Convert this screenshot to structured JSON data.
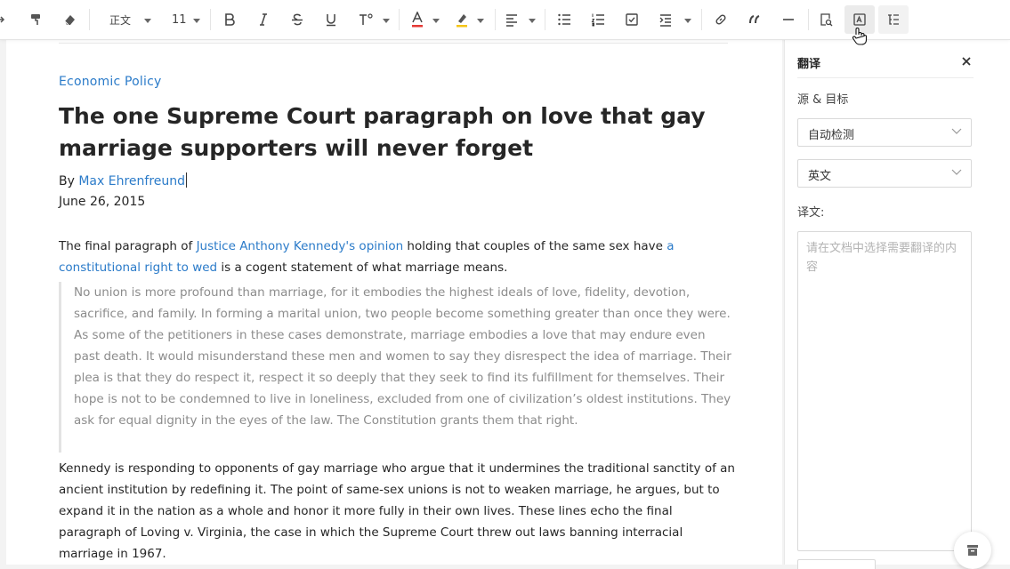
{
  "toolbar": {
    "style_value": "正文",
    "font_size_value": "11",
    "accent_color": "#e53935",
    "highlight_color": "#f5c518"
  },
  "article": {
    "category": "Economic Policy",
    "title": "The one Supreme Court paragraph on love that gay marriage supporters will never forget",
    "byline_prefix": "By ",
    "author": "Max Ehrenfreund",
    "date": "June 26, 2015",
    "p1_a": "The final paragraph of ",
    "p1_link1": "Justice Anthony Kennedy's opinion",
    "p1_b": " holding that couples of the same sex have ",
    "p1_link2": "a constitutional right to wed",
    "p1_c": " is a cogent statement of what marriage means.",
    "quote": "No union is more profound than marriage, for it embodies the highest ideals of love, fidelity, devotion, sacrifice, and family. In forming a marital union, two people become something greater than once they were. As some of the petitioners in these cases demonstrate, marriage embodies a love that may endure even past death. It would misunderstand these men and women to say they disrespect the idea of marriage. Their plea is that they do respect it, respect it so deeply that they seek to find its fulfillment for themselves. Their hope is not to be condemned to live in loneliness, excluded from one of civilization’s oldest institutions. They ask for equal dignity in the eyes of the law. The Constitution grants them that right.",
    "p2": "Kennedy is responding to opponents of gay marriage who argue that it undermines the traditional sanctity of an ancient institution by redefining it. The point of same-sex unions is not to weaken marriage, he argues, but to expand it in the nation as a whole and honor it more fully in their own lives. These lines echo the final paragraph of Loving v. Virginia, the case in which the Supreme Court threw out laws banning interracial marriage in 1967."
  },
  "panel": {
    "title": "翻译",
    "source_target_label": "源 & 目标",
    "source_value": "自动检测",
    "target_value": "英文",
    "translation_label": "译文:",
    "translation_placeholder": "请在文档中选择需要翻译的内容"
  },
  "colors": {
    "link": "#2b7bc9",
    "text": "#262626",
    "quote": "#8c8c8c"
  }
}
